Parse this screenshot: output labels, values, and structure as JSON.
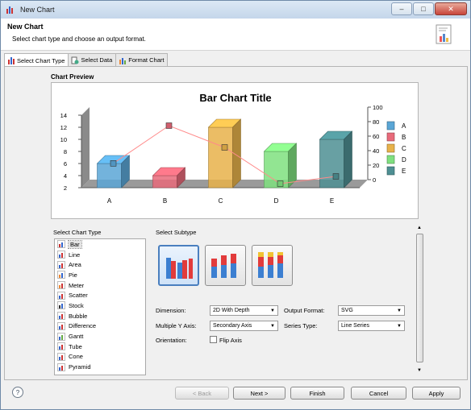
{
  "window": {
    "title": "New Chart"
  },
  "header": {
    "title": "New Chart",
    "description": "Select chart type and choose an output format."
  },
  "tabs": [
    {
      "label": "Select Chart Type",
      "active": true
    },
    {
      "label": "Select Data",
      "active": false
    },
    {
      "label": "Format Chart",
      "active": false
    }
  ],
  "preview": {
    "label": "Chart Preview"
  },
  "chart_data": {
    "type": "bar",
    "title": "Bar Chart Title",
    "categories": [
      "A",
      "B",
      "C",
      "D",
      "E"
    ],
    "series": [
      {
        "values": [
          6,
          4,
          12,
          8,
          10
        ],
        "color": "#5aa6d6",
        "axis": "primary",
        "kind": "bar"
      },
      {
        "values": [
          28,
          80,
          50,
          0,
          10
        ],
        "color": "#ff8a8a",
        "axis": "secondary",
        "kind": "line"
      }
    ],
    "y_left": {
      "range": [
        2,
        14
      ],
      "ticks": [
        "2",
        "4",
        "6",
        "8",
        "10",
        "12",
        "14"
      ]
    },
    "y_right": {
      "range": [
        0,
        100
      ],
      "ticks": [
        "0",
        "20",
        "40",
        "60",
        "80",
        "100"
      ]
    },
    "legend": {
      "position": "right",
      "entries": [
        "A",
        "B",
        "C",
        "D",
        "E"
      ],
      "colors": [
        "#5aa6d6",
        "#e86a7a",
        "#e8b24a",
        "#7fe07f",
        "#4e8f93"
      ]
    }
  },
  "chart_type": {
    "label": "Select Chart Type",
    "items": [
      "Bar",
      "Line",
      "Area",
      "Pie",
      "Meter",
      "Scatter",
      "Stock",
      "Bubble",
      "Difference",
      "Gantt",
      "Tube",
      "Cone",
      "Pyramid"
    ],
    "selected": "Bar"
  },
  "subtype": {
    "label": "Select Subtype"
  },
  "options": {
    "dimension_label": "Dimension:",
    "dimension_value": "2D With Depth",
    "multi_y_label": "Multiple Y Axis:",
    "multi_y_value": "Secondary Axis",
    "orientation_label": "Orientation:",
    "flip_label": "Flip Axis",
    "output_label": "Output Format:",
    "output_value": "SVG",
    "series_type_label": "Series Type:",
    "series_type_value": "Line Series"
  },
  "footer": {
    "back": "< Back",
    "next": "Next >",
    "finish": "Finish",
    "cancel": "Cancel",
    "apply": "Apply",
    "help": "?"
  }
}
